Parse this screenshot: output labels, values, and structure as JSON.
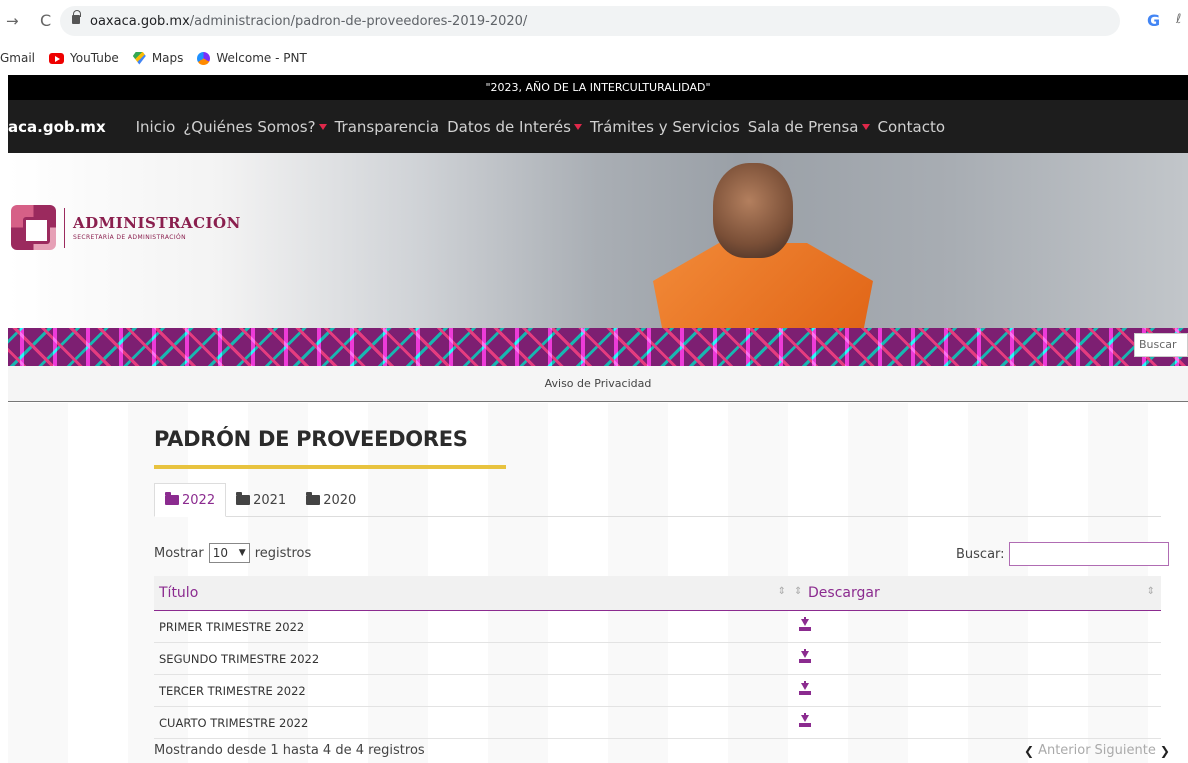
{
  "browser": {
    "url_host": "oaxaca.gob.mx",
    "url_path": "/administracion/padron-de-proveedores-2019-2020/",
    "bookmarks": [
      {
        "label": "Gmail",
        "icon": "gmail-icon"
      },
      {
        "label": "YouTube",
        "icon": "youtube-icon"
      },
      {
        "label": "Maps",
        "icon": "maps-icon"
      },
      {
        "label": "Welcome - PNT",
        "icon": "pnt-icon"
      }
    ]
  },
  "site": {
    "slogan": "\"2023, AÑO DE LA INTERCULTURALIDAD\"",
    "logo_text": "aca.gob.mx",
    "nav": [
      {
        "label": "Inicio",
        "dropdown": false
      },
      {
        "label": "¿Quiénes Somos?",
        "dropdown": true
      },
      {
        "label": "Transparencia",
        "dropdown": false
      },
      {
        "label": "Datos de Interés",
        "dropdown": true
      },
      {
        "label": "Trámites y Servicios",
        "dropdown": false
      },
      {
        "label": "Sala de Prensa",
        "dropdown": true
      },
      {
        "label": "Contacto",
        "dropdown": false
      }
    ],
    "brand_color": "#8b2b8f",
    "accent_color": "#e8c33f"
  },
  "hero": {
    "title": "ADMINISTRACIÓN",
    "subtitle": "SECRETARÍA DE ADMINISTRACIÓN",
    "search_placeholder": "Buscar"
  },
  "privacy_link": "Aviso de Privacidad",
  "main": {
    "title": "PADRÓN DE PROVEEDORES",
    "tabs": [
      {
        "label": "2022",
        "active": true
      },
      {
        "label": "2021",
        "active": false
      },
      {
        "label": "2020",
        "active": false
      }
    ],
    "length_prefix": "Mostrar",
    "length_value": "10",
    "length_suffix": "registros",
    "search_label": "Buscar:",
    "columns": [
      "Título",
      "Descargar"
    ],
    "rows": [
      {
        "title": "PRIMER TRIMESTRE 2022"
      },
      {
        "title": "SEGUNDO TRIMESTRE 2022"
      },
      {
        "title": "TERCER TRIMESTRE 2022"
      },
      {
        "title": "CUARTO TRIMESTRE 2022"
      }
    ],
    "info": "Mostrando desde 1 hasta 4 de 4 registros",
    "pager_prev": "Anterior",
    "pager_next": "Siguiente"
  }
}
